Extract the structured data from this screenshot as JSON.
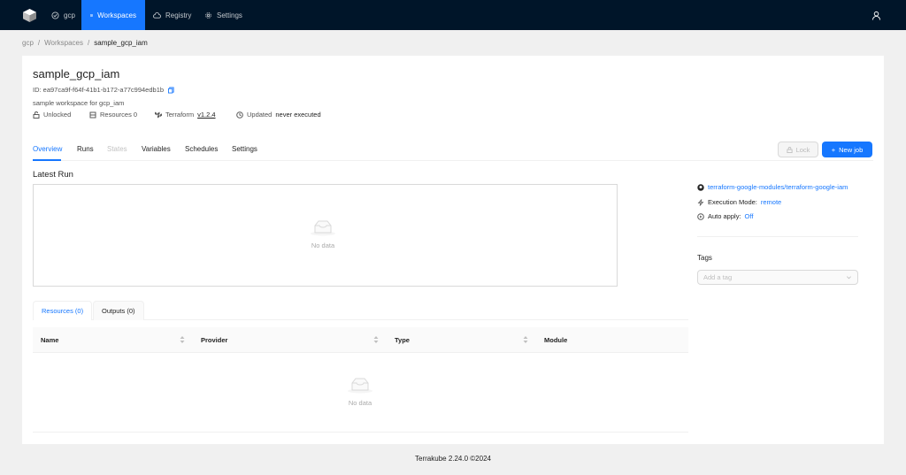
{
  "nav": {
    "org": "gcp",
    "items": [
      {
        "label": "Workspaces",
        "icon": "grid-icon",
        "active": true
      },
      {
        "label": "Registry",
        "icon": "cloud-icon",
        "active": false
      },
      {
        "label": "Settings",
        "icon": "gear-icon",
        "active": false
      }
    ]
  },
  "breadcrumb": [
    "gcp",
    "Workspaces",
    "sample_gcp_iam"
  ],
  "workspace": {
    "title": "sample_gcp_iam",
    "id_label": "ID: ea97ca9f-f64f-41b1-b172-a77c994edb1b",
    "description": "sample workspace for gcp_iam",
    "lock_status": "Unlocked",
    "resources": "Resources 0",
    "tool": "Terraform",
    "tool_version": "v1.2.4",
    "updated_label": "Updated",
    "updated_value": "never executed"
  },
  "tabs": [
    "Overview",
    "Runs",
    "States",
    "Variables",
    "Schedules",
    "Settings"
  ],
  "buttons": {
    "lock": "Lock",
    "new_job": "New job"
  },
  "latest_run": {
    "title": "Latest Run",
    "empty": "No data"
  },
  "side": {
    "repo": "terraform-google-modules/terraform-google-iam",
    "execution_label": "Execution Mode:",
    "execution_value": "remote",
    "auto_apply_label": "Auto apply:",
    "auto_apply_value": "Off",
    "tags_title": "Tags",
    "tag_placeholder": "Add a tag"
  },
  "subtabs": [
    "Resources (0)",
    "Outputs (0)"
  ],
  "table": {
    "columns": [
      "Name",
      "Provider",
      "Type",
      "Module"
    ],
    "empty": "No data"
  },
  "footer": "Terrakube 2.24.0 ©2024",
  "colors": {
    "nav_bg": "#001529",
    "accent": "#1677ff"
  }
}
